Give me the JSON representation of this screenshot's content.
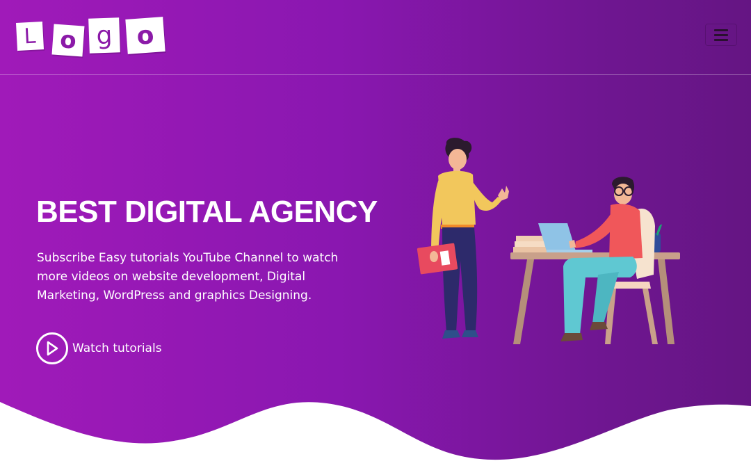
{
  "navbar": {
    "logo_letters": [
      "L",
      "o",
      "g",
      "o"
    ],
    "menu_icon": "hamburger-icon"
  },
  "hero": {
    "headline": "BEST DIGITAL AGENCY",
    "subtext": "Subscribe Easy tutorials YouTube Channel to watch more videos on website development, Digital Marketing, WordPress and graphics Designing.",
    "cta_label": "Watch tutorials",
    "cta_icon": "play-icon"
  },
  "colors": {
    "gradient_start": "#a01ab9",
    "gradient_end": "#651583",
    "text": "#ffffff",
    "logo_letter": "#8b1aa8"
  }
}
